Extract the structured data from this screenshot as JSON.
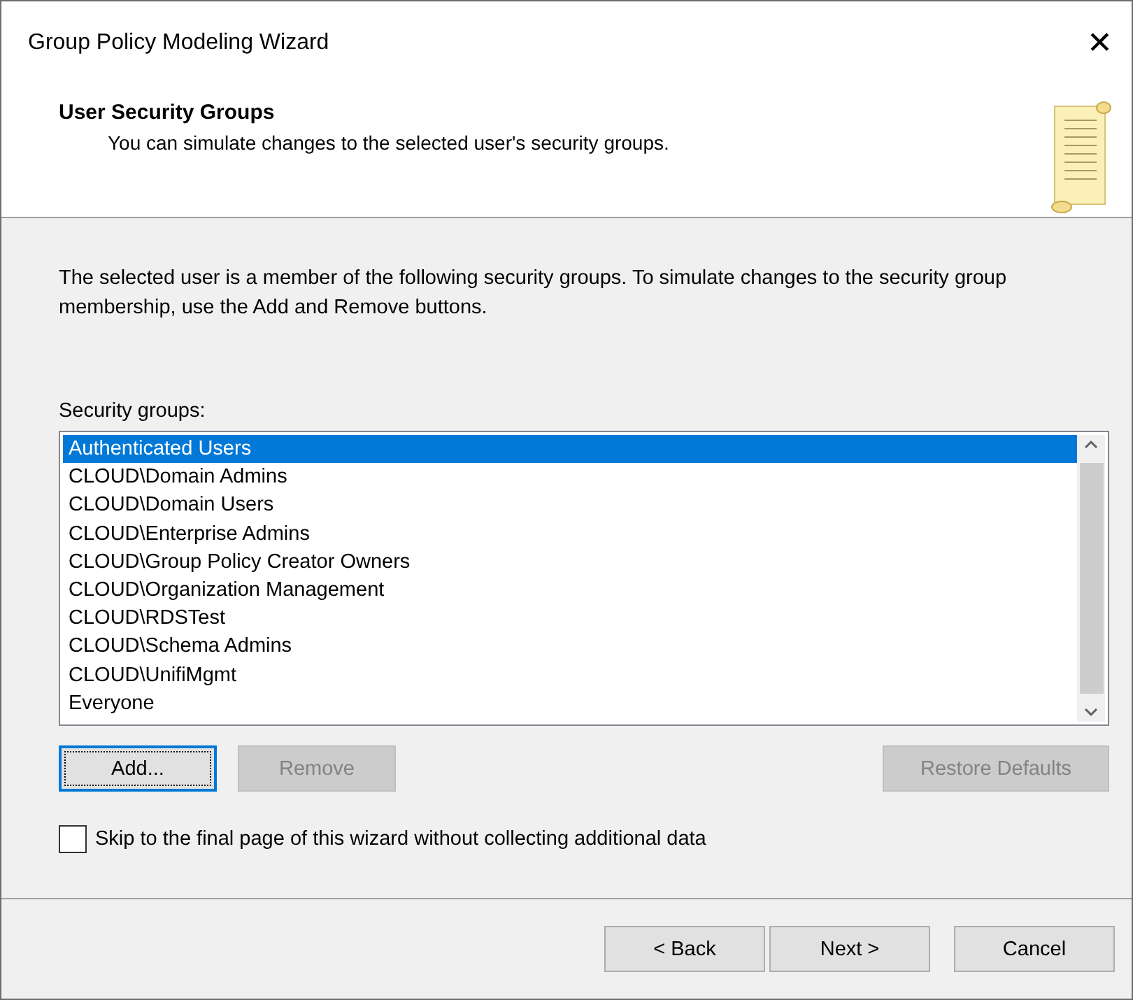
{
  "window": {
    "title": "Group Policy Modeling Wizard",
    "close": "✕"
  },
  "header": {
    "title": "User Security Groups",
    "subtitle": "You can simulate changes to the selected user's security groups."
  },
  "intro": "The selected user is a member of the following security groups. To simulate changes to the security group membership, use the Add and Remove buttons.",
  "groups_label": "Security groups:",
  "groups": [
    {
      "name": "Authenticated Users",
      "selected": true
    },
    {
      "name": "CLOUD\\Domain Admins",
      "selected": false
    },
    {
      "name": "CLOUD\\Domain Users",
      "selected": false
    },
    {
      "name": "CLOUD\\Enterprise Admins",
      "selected": false
    },
    {
      "name": "CLOUD\\Group Policy Creator Owners",
      "selected": false
    },
    {
      "name": "CLOUD\\Organization Management",
      "selected": false
    },
    {
      "name": "CLOUD\\RDSTest",
      "selected": false
    },
    {
      "name": "CLOUD\\Schema Admins",
      "selected": false
    },
    {
      "name": "CLOUD\\UnifiMgmt",
      "selected": false
    },
    {
      "name": "Everyone",
      "selected": false
    }
  ],
  "list_buttons": [
    {
      "label": "Add...",
      "disabled": false,
      "focused": true
    },
    {
      "label": "Remove",
      "disabled": true,
      "focused": false
    },
    {
      "label": "Restore Defaults",
      "disabled": true,
      "focused": false
    }
  ],
  "skip_option": {
    "label": "Skip to the final page of this wizard without collecting additional data",
    "checked": false
  },
  "nav_buttons": [
    {
      "label": "< Back"
    },
    {
      "label": "Next >"
    },
    {
      "label": "Cancel"
    }
  ]
}
